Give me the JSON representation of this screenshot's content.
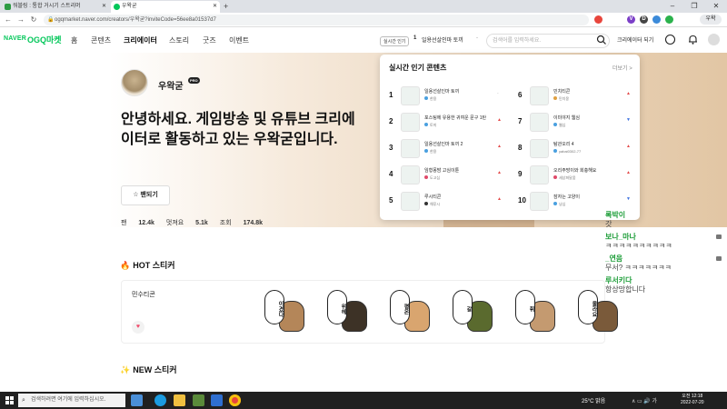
{
  "browser": {
    "tabs": [
      {
        "label": "워블링 : 통합 거시기 스트리머",
        "favicon_color": "#2d9b43"
      },
      {
        "label": "우왁굳",
        "favicon_color": "#03c75a"
      }
    ],
    "new_tab": "+",
    "url": "ogqmarket.naver.com/creators/우왁굳?inviteCode=56ee8a01537d7",
    "profile_label": "우왁",
    "window_controls": [
      "–",
      "❐",
      "✕"
    ],
    "extensions": [
      {
        "label": "",
        "color": "#e8453c"
      },
      {
        "label": "V",
        "color": "#7b3fc7"
      },
      {
        "label": "D",
        "color": "#444"
      },
      {
        "label": "",
        "color": "#3b8ad9"
      },
      {
        "label": "",
        "color": "#2bb24c"
      }
    ]
  },
  "site": {
    "logo_naver": "NAVER",
    "logo_ogq": "OGQ마켓",
    "nav": [
      "홈",
      "콘텐츠",
      "크리에이터",
      "스토리",
      "굿즈",
      "이벤트"
    ],
    "active_nav": "크리에이터",
    "rank_badge": "실시간 인기",
    "rank_num": "1",
    "rank_title": "일용선살인마 토끼",
    "rank_dash": "-",
    "search_placeholder": "검색어를 입력하세요.",
    "creator_shop": "크리에이터 되기"
  },
  "creator": {
    "name": "우왁굳",
    "badge": "PRO",
    "headline": "안녕하세요. 게임방송 및 유튜브 크리에이터로 활동하고 있는 우왁굳입니다.",
    "fan_button": "팬되기",
    "stats": [
      {
        "label": "팬",
        "value": "12.4k"
      },
      {
        "label": "멋져요",
        "value": "5.1k"
      },
      {
        "label": "조회",
        "value": "174.8k"
      }
    ]
  },
  "popup": {
    "title": "실시간 인기 콘텐츠",
    "more": "더보기 >",
    "items": [
      {
        "rank": "1",
        "title": "일용선살인마 토끼",
        "author": "한용",
        "trend": "-",
        "trend_class": "trend-same",
        "dot": "#4aa0e0"
      },
      {
        "rank": "2",
        "title": "포스팅에 유용한 귀여운 문구 1탄",
        "author": "토끼",
        "trend": "▲",
        "trend_class": "trend-up",
        "dot": "#4aa0e0"
      },
      {
        "rank": "3",
        "title": "일용선살인마 토끼 2",
        "author": "한용",
        "trend": "▲",
        "trend_class": "trend-up",
        "dot": "#4aa0e0"
      },
      {
        "rank": "4",
        "title": "임형몽밤 고심이툰",
        "author": "도고심",
        "trend": "▲",
        "trend_class": "trend-up",
        "dot": "#e04a6a"
      },
      {
        "rank": "5",
        "title": "루시티콘",
        "author": "해루시",
        "trend": "▲",
        "trend_class": "trend-up",
        "dot": "#333"
      },
      {
        "rank": "6",
        "title": "민치티콘",
        "author": "민치몽",
        "trend": "▲",
        "trend_class": "trend-up",
        "dot": "#e0a040"
      },
      {
        "rank": "7",
        "title": "이미야지 웹심",
        "author": "웹심",
        "trend": "▼",
        "trend_class": "trend-down",
        "dot": "#4aa0e0"
      },
      {
        "rank": "8",
        "title": "탐관오리 4",
        "author": "yabai0302-77",
        "trend": "▲",
        "trend_class": "trend-up",
        "dot": "#4aa0e0"
      },
      {
        "rank": "9",
        "title": "오리주방이와 회충해요",
        "author": "세상퍼달뭄",
        "trend": "▲",
        "trend_class": "trend-up",
        "dot": "#e04a6a"
      },
      {
        "rank": "10",
        "title": "잠자는 고양이",
        "author": "냥심",
        "trend": "▼",
        "trend_class": "trend-down",
        "dot": "#4aa0e0"
      }
    ]
  },
  "hot": {
    "title": "HOT 스티커",
    "item_name": "민수티콘",
    "stickers": [
      {
        "bubble": "이겼다",
        "face": "#b48659"
      },
      {
        "bubble": "위헤",
        "face": "#3d3226"
      },
      {
        "bubble": "평온",
        "face": "#d9a56f"
      },
      {
        "bubble": "갈",
        "face": "#5a6a2e"
      },
      {
        "bubble": "휘",
        "face": "#c49a70"
      },
      {
        "bubble": "몰라요",
        "face": "#7a5a3a"
      }
    ]
  },
  "new_section": {
    "title": "NEW 스티커"
  },
  "chat": [
    {
      "text": "록박이",
      "kind": "nick"
    },
    {
      "text": "갓",
      "kind": "msg"
    },
    {
      "text": "보나_마나",
      "kind": "nick"
    },
    {
      "text": "ㅋㅋㅋㅋㅋㅋㅋㅋㅋㅋ",
      "kind": "msg"
    },
    {
      "text": "_연음",
      "kind": "nick"
    },
    {
      "text": "무서? ㅋㅋㅋㅋㅋㅋㅋ",
      "kind": "msg"
    },
    {
      "text": "루서키다",
      "kind": "nick"
    },
    {
      "text": "항상망합니다",
      "kind": "msg"
    }
  ],
  "taskbar": {
    "search_placeholder": "검색하려면 여기에 입력하십시오.",
    "weather": "25°C 맑음",
    "tray": "∧  ▭  🔊  가",
    "time": "오전 12:18",
    "date": "2022-07-20"
  },
  "colors": {
    "brand": "#03c75a",
    "trend_up": "#e34a4a",
    "trend_down": "#3d72e0"
  }
}
